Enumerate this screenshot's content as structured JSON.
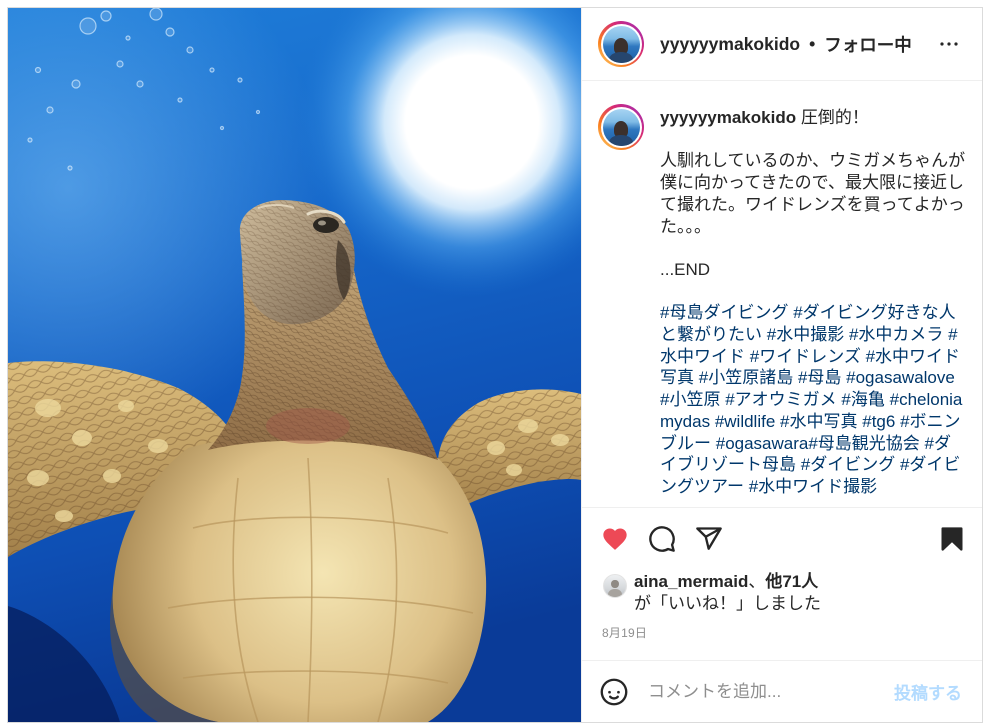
{
  "post": {
    "header": {
      "username": "yyyyyymakokido",
      "separator": "•",
      "follow_status": "フォロー中",
      "menu_icon": "more-horizontal-icon"
    },
    "caption": {
      "username": "yyyyyymakokido",
      "title": "圧倒的！",
      "body": "人馴れしているのか、ウミガメちゃんが僕に向かってきたので、最大限に接近して撮れた。ワイドレンズを買ってよかった。。。",
      "ending": "...END",
      "hashtags": [
        "#母島ダイビング",
        "#ダイビング好きな人と繋がりたい",
        "#水中撮影",
        "#水中カメラ",
        "#水中ワイド",
        "#ワイドレンズ",
        "#水中ワイド写真",
        "#小笠原諸島",
        "#母島",
        "#ogasawalove",
        "#小笠原",
        "#アオウミガメ",
        "#海亀",
        "#cheloniamydas",
        "#wildlife",
        "#水中写真",
        "#tg6",
        "#ボニンブルー",
        "#ogasawara#母島観光協会",
        "#ダイブリゾート母島",
        "#ダイビング",
        "#ダイビングツアー",
        "#水中ワイド撮影"
      ]
    },
    "actions": {
      "like_icon": "heart-filled-icon",
      "comment_icon": "comment-icon",
      "share_icon": "paper-plane-icon",
      "save_icon": "bookmark-filled-icon",
      "liked": true,
      "saved": true
    },
    "likes": {
      "liker": "aina_mermaid",
      "separator": "、",
      "others": "他71人",
      "suffix": "が「いいね！」しました"
    },
    "date": "8月19日",
    "comment_box": {
      "emoji_icon": "smiley-icon",
      "placeholder": "コメントを追加...",
      "submit_label": "投稿する"
    }
  },
  "colors": {
    "text": "#262626",
    "link": "#00376b",
    "muted": "#8e8e8e",
    "like": "#ed4956",
    "submit_disabled": "#b3dbff",
    "border": "#dbdbdb"
  }
}
